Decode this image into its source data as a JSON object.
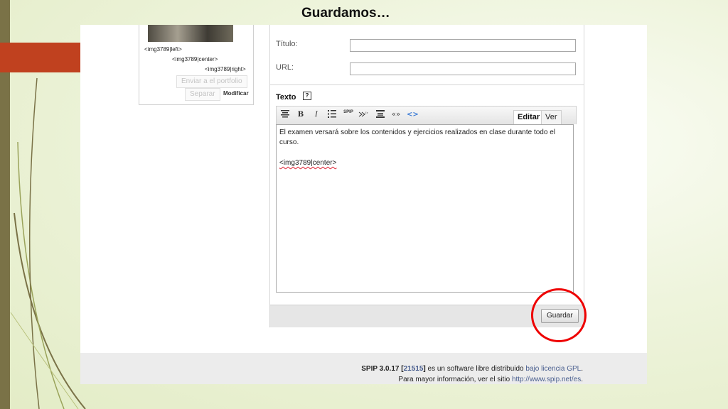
{
  "slide": {
    "title": "Guardamos…"
  },
  "gallery": {
    "tags": [
      "<img3789|left>",
      "<img3789|center>",
      "<img3789|right>"
    ],
    "send_portfolio": "Enviar a el portfolio",
    "separate": "Separar",
    "modify": "Modificar"
  },
  "form": {
    "title_label": "Título:",
    "title_value": "",
    "url_label": "URL:",
    "url_value": "",
    "text_label": "Texto",
    "help_icon": "?"
  },
  "editor": {
    "toolbar": {
      "bold": "B",
      "italic": "I",
      "quote": "«»",
      "code": "<>",
      "spip": "SPIP"
    },
    "tabs": {
      "edit": "Editar",
      "view": "Ver"
    },
    "paragraph1": "El examen versará sobre los contenidos y ejercicios realizados en clase durante todo el curso.",
    "paragraph2": "<img3789|center>"
  },
  "actions": {
    "save": "Guardar"
  },
  "footer": {
    "version": "SPIP 3.0.17",
    "revision": "21515",
    "license_prefix": "es un software libre distribuido",
    "license_link": "bajo licencia GPL",
    "more_info_prefix": "Para mayor información, ver el sitio",
    "more_info_link": "http://www.spip.net/es"
  },
  "colors": {
    "highlight": "#e00000",
    "accent_bar": "#c0411f",
    "left_bar": "#7a7247"
  }
}
